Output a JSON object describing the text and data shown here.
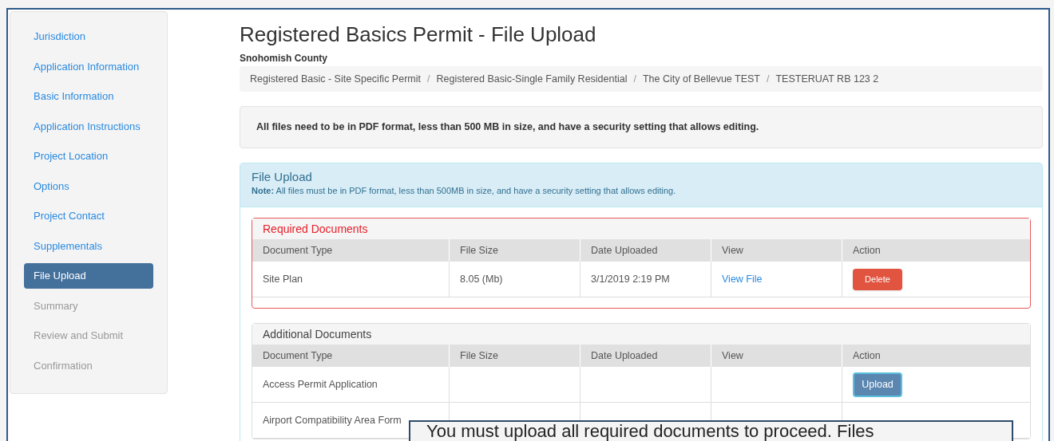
{
  "sidebar": {
    "items": [
      {
        "label": "Jurisdiction",
        "selected": false,
        "disabled": false
      },
      {
        "label": "Application Information",
        "selected": false,
        "disabled": false
      },
      {
        "label": "Basic Information",
        "selected": false,
        "disabled": false
      },
      {
        "label": "Application Instructions",
        "selected": false,
        "disabled": false
      },
      {
        "label": "Project Location",
        "selected": false,
        "disabled": false
      },
      {
        "label": "Options",
        "selected": false,
        "disabled": false
      },
      {
        "label": "Project Contact",
        "selected": false,
        "disabled": false
      },
      {
        "label": "Supplementals",
        "selected": false,
        "disabled": false
      },
      {
        "label": "File Upload",
        "selected": true,
        "disabled": false
      },
      {
        "label": "Summary",
        "selected": false,
        "disabled": true
      },
      {
        "label": "Review and Submit",
        "selected": false,
        "disabled": true
      },
      {
        "label": "Confirmation",
        "selected": false,
        "disabled": true
      }
    ]
  },
  "page_title": "Registered Basics Permit - File Upload",
  "subtitle": "Snohomish County",
  "breadcrumb": [
    "Registered Basic - Site Specific Permit",
    "Registered Basic-Single Family Residential",
    "The City of Bellevue TEST",
    "TESTERUAT RB 123 2"
  ],
  "breadcrumb_separator": "/",
  "alert": "All files need to be in PDF format, less than 500 MB in size, and have a security setting that allows editing.",
  "file_upload_panel": {
    "title": "File Upload",
    "note": "**Note:** All files must be in PDF format, less than 500MB in size, and have a security setting that allows editing.",
    "sections": [
      {
        "title": "Required Documents",
        "kind": "required",
        "columns": [
          "Document Type",
          "File Size",
          "Date Uploaded",
          "View",
          "Action"
        ],
        "rows": [
          {
            "document_type": "Site Plan",
            "file_size": "8.05 (Mb)",
            "date_uploaded": "3/1/2019 2:19 PM",
            "view": "View File",
            "action": {
              "kind": "delete",
              "label": "Delete"
            }
          }
        ]
      },
      {
        "title": "Additional Documents",
        "kind": "additional",
        "columns": [
          "Document Type",
          "File Size",
          "Date Uploaded",
          "View",
          "Action"
        ],
        "rows": [
          {
            "document_type": "Access Permit Application",
            "action": {
              "kind": "upload",
              "label": "Upload"
            }
          },
          {
            "document_type": "Airport Compatibility Area Form"
          }
        ]
      }
    ]
  },
  "callout": "You must upload all required documents to proceed. Files"
}
